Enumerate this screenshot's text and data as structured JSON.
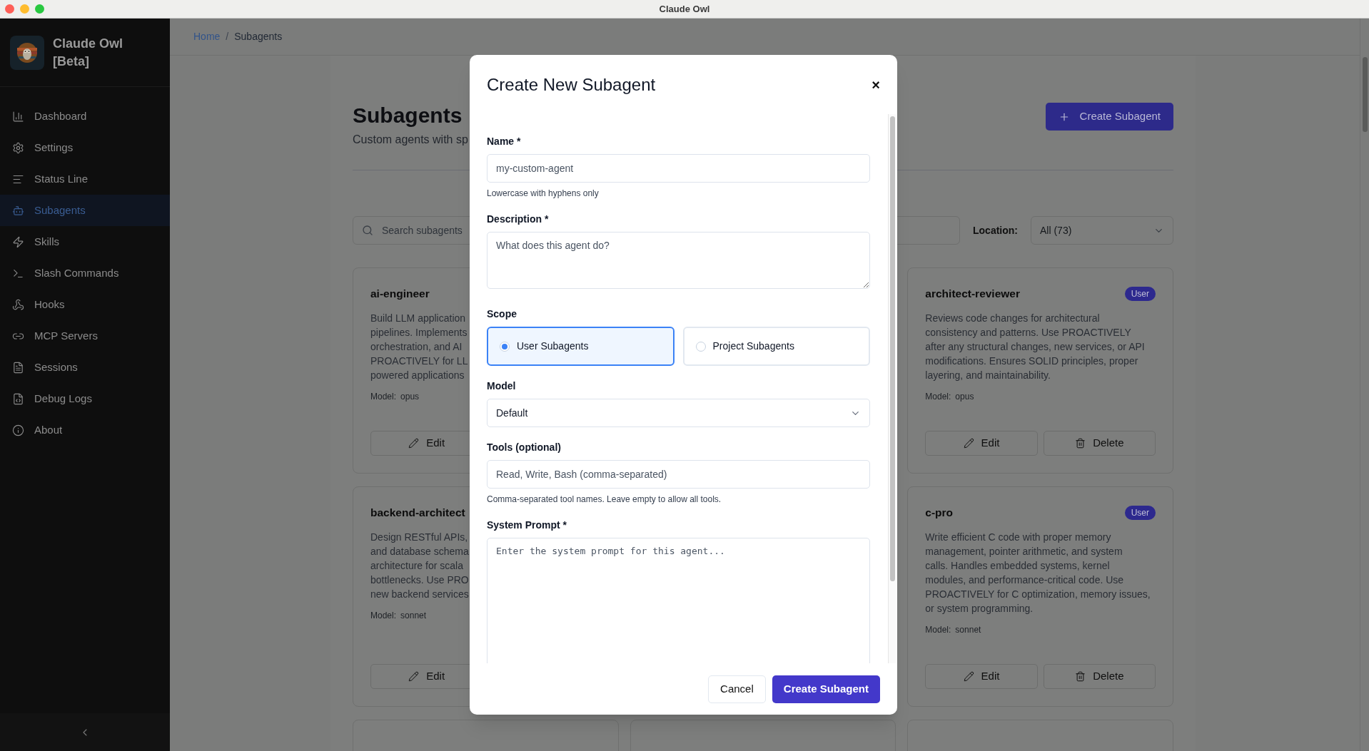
{
  "window": {
    "title": "Claude Owl"
  },
  "sidebar": {
    "brand": "Claude Owl [Beta]",
    "items": [
      {
        "label": "Dashboard",
        "selected": false
      },
      {
        "label": "Settings",
        "selected": false
      },
      {
        "label": "Status Line",
        "selected": false
      },
      {
        "label": "Subagents",
        "selected": true
      },
      {
        "label": "Skills",
        "selected": false
      },
      {
        "label": "Slash Commands",
        "selected": false
      },
      {
        "label": "Hooks",
        "selected": false
      },
      {
        "label": "MCP Servers",
        "selected": false
      },
      {
        "label": "Sessions",
        "selected": false
      },
      {
        "label": "Debug Logs",
        "selected": false
      },
      {
        "label": "About",
        "selected": false
      }
    ]
  },
  "breadcrumb": [
    "Home",
    "/",
    "Subagents"
  ],
  "page": {
    "title": "Subagents",
    "subtitle": "Custom agents with sp",
    "create_button": "Create Subagent",
    "search": {
      "placeholder": "Search subagents"
    },
    "location": {
      "label": "Location:",
      "value": "All (73)"
    }
  },
  "card_rows": [
    {
      "left": {
        "title": "ai-engineer",
        "description_lines": [
          "Build LLM application",
          "pipelines. Implements",
          "orchestration, and AI",
          "PROACTIVELY for LL",
          "powered applications"
        ],
        "model_label": "Model:",
        "model": "opus",
        "buttons": [
          {
            "label": "Edit",
            "kind": "edit"
          }
        ]
      },
      "right": {
        "title": "architect-reviewer",
        "badge": "User",
        "description_lines": [
          "Reviews code changes for architectural",
          "consistency and patterns. Use PROACTIVELY",
          "after any structural changes, new services, or API",
          "modifications. Ensures SOLID principles, proper",
          "layering, and maintainability."
        ],
        "model_label": "Model:",
        "model": "opus",
        "buttons": [
          {
            "label": "Edit",
            "kind": "edit"
          },
          {
            "label": "Delete",
            "kind": "delete"
          }
        ]
      }
    },
    {
      "left": {
        "title": "backend-architect",
        "description_lines": [
          "Design RESTful APIs,",
          "and database schema",
          "architecture for scala",
          "bottlenecks. Use PRO",
          "new backend services"
        ],
        "model_label": "Model:",
        "model": "sonnet",
        "buttons": [
          {
            "label": "Edit",
            "kind": "edit"
          }
        ]
      },
      "right": {
        "title": "c-pro",
        "badge": "User",
        "description_lines": [
          "Write efficient C code with proper memory",
          "management, pointer arithmetic, and system",
          "calls. Handles embedded systems, kernel",
          "modules, and performance-critical code. Use",
          "PROACTIVELY for C optimization, memory issues,",
          "or system programming."
        ],
        "model_label": "Model:",
        "model": "sonnet",
        "buttons": [
          {
            "label": "Edit",
            "kind": "edit"
          },
          {
            "label": "Delete",
            "kind": "delete"
          }
        ]
      }
    }
  ],
  "dialog": {
    "title": "Create New Subagent",
    "close": "×",
    "fields": [
      {
        "kind": "text",
        "label": "Name *",
        "placeholder": "my-custom-agent",
        "hint": "Lowercase with hyphens only"
      },
      {
        "kind": "textarea",
        "label": "Description *",
        "placeholder": "What does this agent do?"
      },
      {
        "kind": "radio",
        "label": "Scope",
        "options": [
          {
            "label": "User Subagents",
            "selected": true
          },
          {
            "label": "Project Subagents",
            "selected": false
          }
        ]
      },
      {
        "kind": "select",
        "label": "Model",
        "value": "Default"
      },
      {
        "kind": "text",
        "label": "Tools (optional)",
        "placeholder": "Read, Write, Bash (comma-separated)",
        "hint": "Comma-separated tool names. Leave empty to allow all tools."
      },
      {
        "kind": "code",
        "label": "System Prompt *",
        "placeholder": "Enter the system prompt for this agent..."
      }
    ],
    "buttons": [
      {
        "label": "Cancel",
        "kind": "secondary"
      },
      {
        "label": "Create Subagent",
        "kind": "primary"
      }
    ]
  }
}
